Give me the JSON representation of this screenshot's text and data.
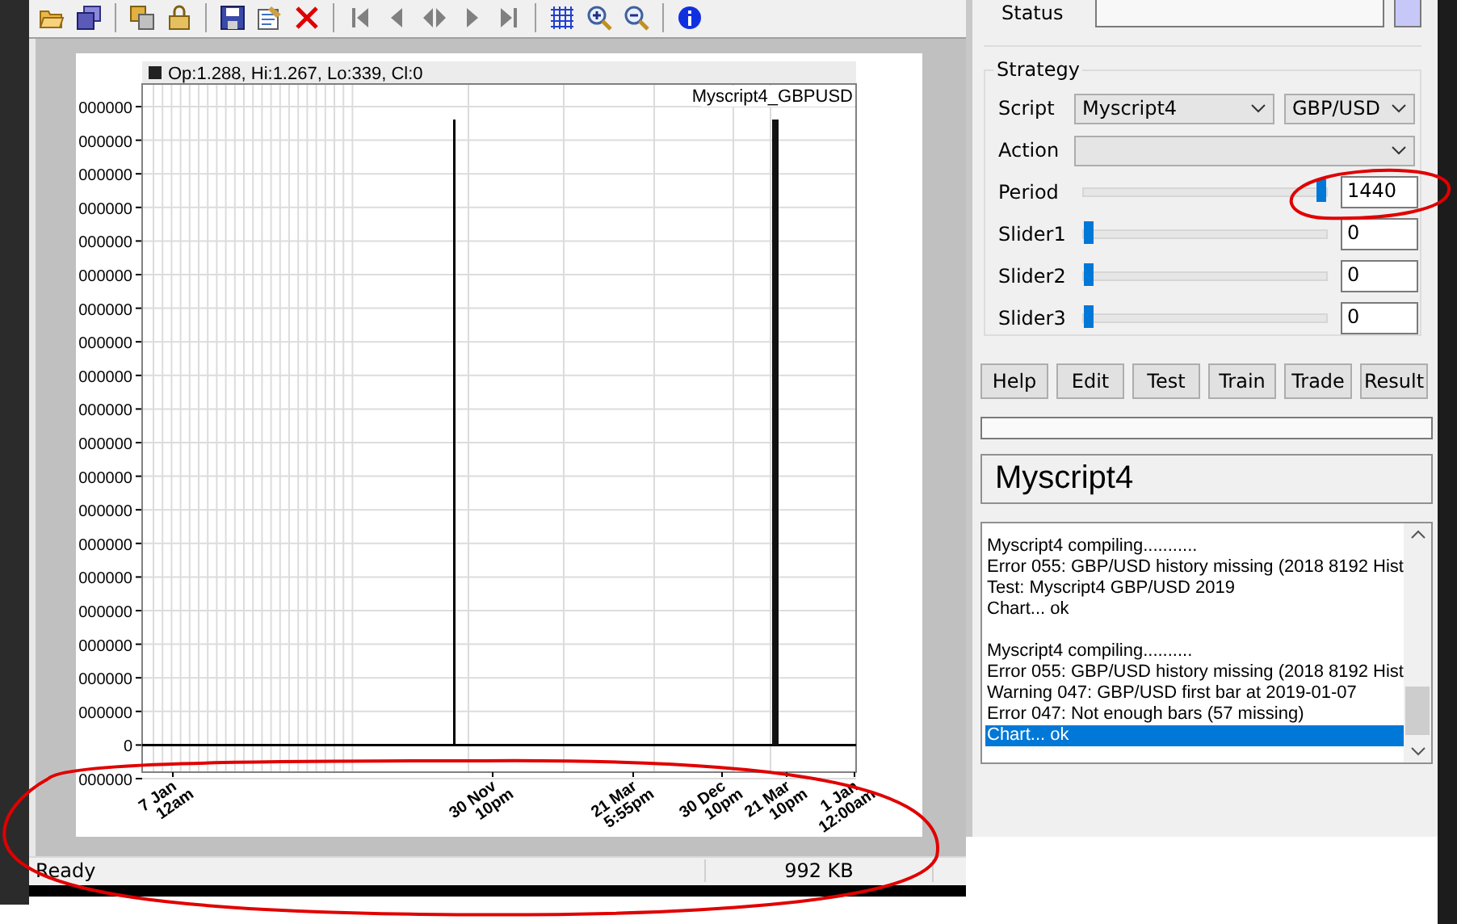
{
  "toolbar": [
    {
      "kind": "folder"
    },
    {
      "kind": "windows"
    },
    {
      "kind": "separator"
    },
    {
      "kind": "copy"
    },
    {
      "kind": "lock"
    },
    {
      "kind": "separator"
    },
    {
      "kind": "floppy"
    },
    {
      "kind": "note"
    },
    {
      "kind": "delete"
    },
    {
      "kind": "separator"
    },
    {
      "kind": "first"
    },
    {
      "kind": "prev"
    },
    {
      "kind": "prevnext"
    },
    {
      "kind": "next"
    },
    {
      "kind": "last"
    },
    {
      "kind": "separator"
    },
    {
      "kind": "grid"
    },
    {
      "kind": "zoomin"
    },
    {
      "kind": "zoomout"
    },
    {
      "kind": "separator"
    },
    {
      "kind": "info"
    }
  ],
  "chart": {
    "legend": "Op:1.288, Hi:1.267, Lo:339, Cl:0",
    "name": "Myscript4_GBPUSD",
    "y_labels": [
      "000000",
      "000000",
      "000000",
      "000000",
      "000000",
      "000000",
      "000000",
      "000000",
      "000000",
      "000000",
      "000000",
      "000000",
      "000000",
      "000000",
      "000000",
      "000000",
      "000000",
      "000000",
      "000000",
      "0",
      "000000"
    ],
    "x_labels": [
      {
        "date": "7 Jan",
        "time": "12am"
      },
      {
        "date": "30 Nov",
        "time": "10pm"
      },
      {
        "date": "21 Mar",
        "time": "5:55pm"
      },
      {
        "date": "30 Dec",
        "time": "10pm"
      },
      {
        "date": "21 Mar",
        "time": "10pm"
      },
      {
        "date": "1 Jan",
        "time": "12:00am"
      }
    ]
  },
  "status_bar": {
    "message": "Ready",
    "memory": "992 KB"
  },
  "panel": {
    "status_label": "Status",
    "group_title": "Strategy",
    "script_label": "Script",
    "script": "Myscript4",
    "asset": "GBP/USD",
    "action_label": "Action",
    "sliders": [
      {
        "label": "Period",
        "level": 1.0,
        "value": "1440"
      },
      {
        "label": "Slider1",
        "level": 0,
        "value": "0"
      },
      {
        "label": "Slider2",
        "level": 0,
        "value": "0"
      },
      {
        "label": "Slider3",
        "level": 0,
        "value": "0"
      }
    ],
    "buttons": [
      "Help",
      "Edit",
      "Test",
      "Train",
      "Trade",
      "Result"
    ],
    "progress": {
      "level": 0
    },
    "title": "Myscript4",
    "log_groups": [
      [
        {
          "text": "Myscript4 compiling...........",
          "selected": false
        },
        {
          "text": "Error 055: GBP/USD history missing (2018 8192 Hist",
          "selected": false
        },
        {
          "text": "Test: Myscript4 GBP/USD 2019",
          "selected": false
        },
        {
          "text": "Chart... ok",
          "selected": false
        }
      ],
      [
        {
          "text": "Myscript4 compiling..........",
          "selected": false
        },
        {
          "text": "Error 055: GBP/USD history missing (2018 8192 Hist",
          "selected": false
        },
        {
          "text": "Warning 047: GBP/USD first bar at 2019-01-07",
          "selected": false
        },
        {
          "text": "Error 047: Not enough bars (57 missing)",
          "selected": false
        },
        {
          "text": "Chart... ok",
          "selected": true
        }
      ]
    ]
  }
}
